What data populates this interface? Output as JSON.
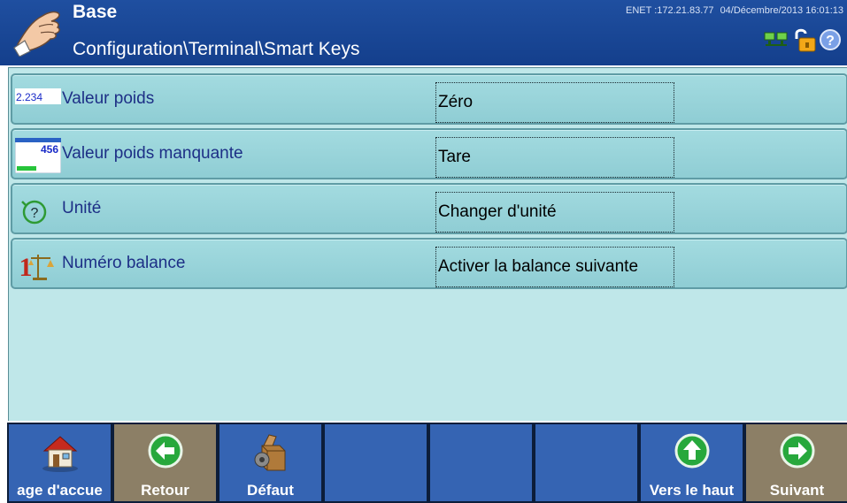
{
  "header": {
    "title": "Base",
    "breadcrumb": "Configuration\\Terminal\\Smart Keys",
    "network": "ENET :172.21.83.77",
    "datetime": "04/Décembre/2013 16:01:13",
    "icons": [
      "hand-icon",
      "network-icon",
      "unlocked-padlock-icon",
      "help-icon"
    ]
  },
  "list": {
    "rows": [
      {
        "icon": "weight-value-icon",
        "icon_text": "2.234",
        "label": "Valeur poids",
        "value": "Zéro"
      },
      {
        "icon": "missing-weight-icon",
        "icon_text": "456",
        "label": "Valeur poids manquante",
        "value": "Tare"
      },
      {
        "icon": "unit-question-icon",
        "icon_text": "?",
        "label": "Unité",
        "value": "Changer d'unité"
      },
      {
        "icon": "scale-number-icon",
        "icon_text": "1",
        "label": "Numéro balance",
        "value": "Activer la balance suivante"
      }
    ]
  },
  "softkeys": [
    {
      "label": "age d'accue",
      "icon": "home-icon",
      "color": "#3564b3"
    },
    {
      "label": "Retour",
      "icon": "arrow-left-icon",
      "color": "#8c7f66"
    },
    {
      "label": "Défaut",
      "icon": "default-box-icon",
      "color": "#3564b3"
    },
    {
      "label": "",
      "icon": "",
      "color": "#3564b3"
    },
    {
      "label": "",
      "icon": "",
      "color": "#3564b3"
    },
    {
      "label": "",
      "icon": "",
      "color": "#3564b3"
    },
    {
      "label": "Vers le haut",
      "icon": "arrow-up-icon",
      "color": "#3564b3"
    },
    {
      "label": "Suivant",
      "icon": "arrow-right-icon",
      "color": "#8c7f66"
    }
  ],
  "colors": {
    "header": "#1a4796",
    "list_background": "#bfe7e9",
    "row": "#99d4da",
    "row_label": "#1d2f86",
    "softkey_blue": "#3564b3",
    "softkey_tan": "#8c7f66",
    "arrow_green": "#27a83c"
  }
}
